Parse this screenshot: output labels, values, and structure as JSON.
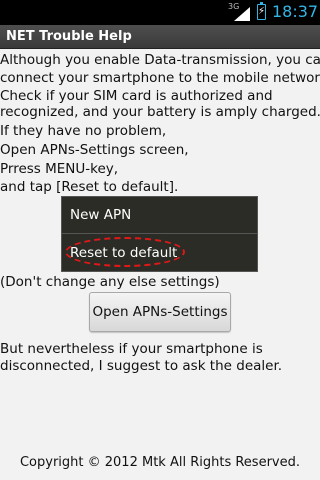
{
  "status_bar": {
    "network_label": "3G",
    "time": "18:37"
  },
  "title_bar": {
    "title": "NET Trouble Help"
  },
  "content": {
    "lines": [
      "Although you enable Data-transmission, you can't",
      "connect your smartphone to the mobile network…",
      "Check if your SIM card is authorized and",
      "recognized, and your battery is amply charged.",
      "If they have no problem,",
      "Open APNs-Settings screen,",
      "Prress MENU-key,",
      "and tap [Reset to default]."
    ],
    "menu_screenshot": {
      "item1": "New APN",
      "item2": "Reset to default"
    },
    "note": "(Don't change any else settings)",
    "open_button_label": "Open APNs-Settings",
    "closing_lines": [
      "But nevertheless if your smartphone is",
      "disconnected, I suggest to ask the dealer."
    ]
  },
  "footer": {
    "copyright": "Copyright © 2012 Mtk All Rights Reserved."
  },
  "colors": {
    "status_accent": "#33b5e5",
    "highlight_red": "#e11818"
  }
}
